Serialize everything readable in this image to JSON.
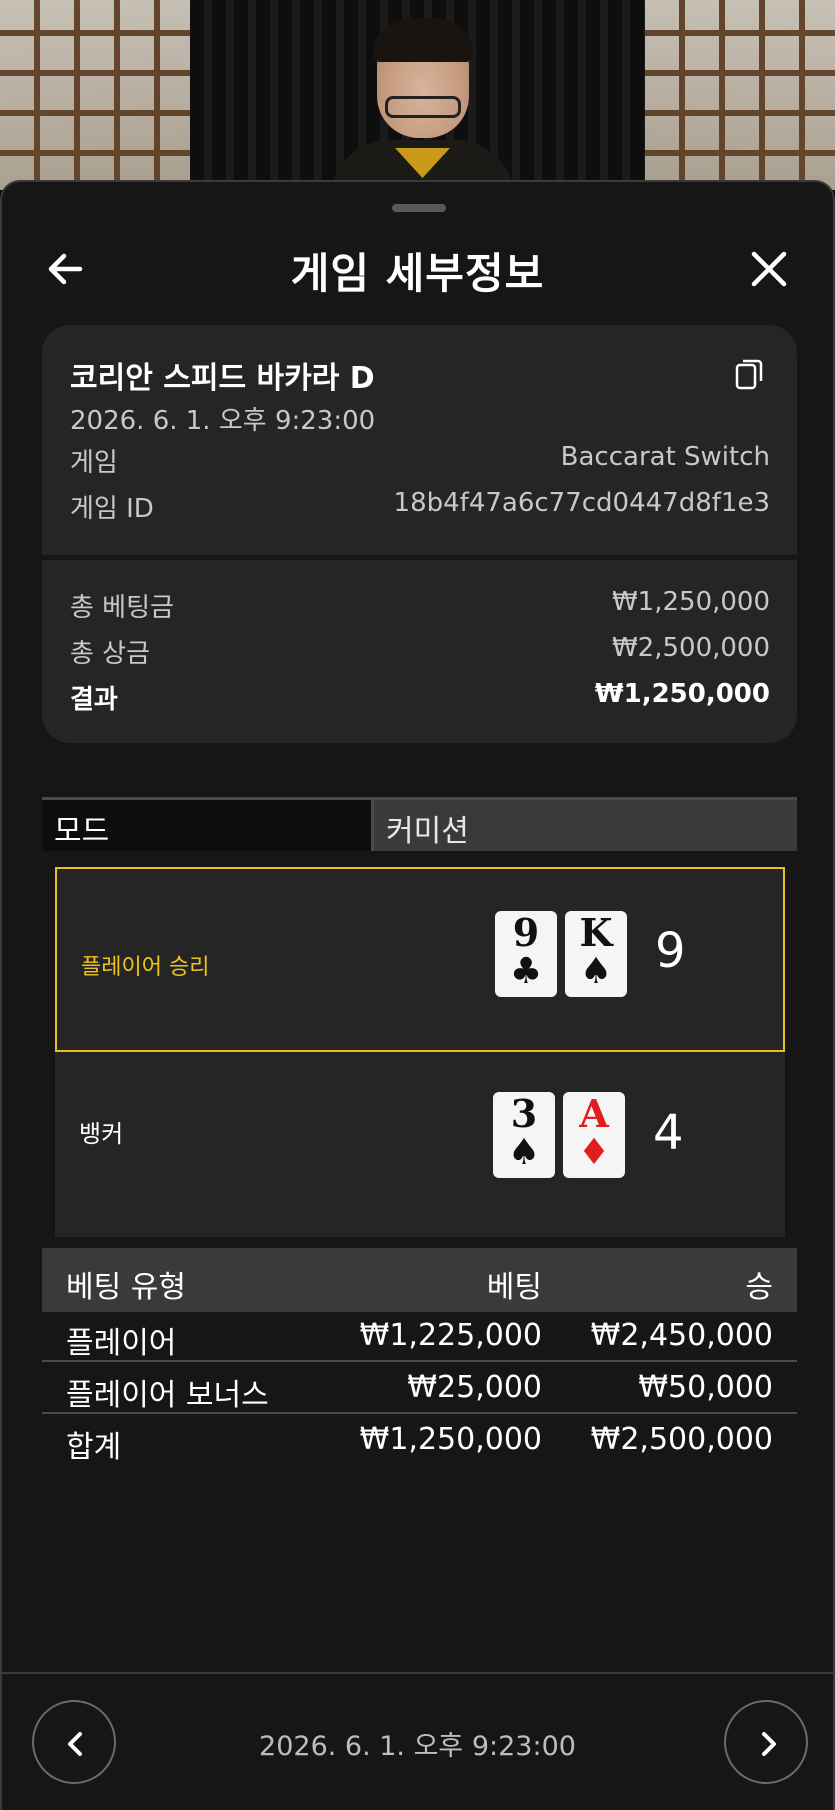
{
  "header": {
    "title": "게임 세부정보"
  },
  "info": {
    "game_name": "코리안 스피드 바카라 D",
    "date": "2026. 6. 1. 오후 9:23:00",
    "game_label": "게임",
    "game_value": "Baccarat Switch",
    "game_id_label": "게임 ID",
    "game_id_value": "18b4f47a6c77cd0447d8f1e3",
    "total_bet_label": "총 베팅금",
    "total_bet_value": "₩1,250,000",
    "total_win_label": "총 상금",
    "total_win_value": "₩2,500,000",
    "result_label": "결과",
    "result_value": "₩1,250,000"
  },
  "tabs": {
    "mode": "모드",
    "commission": "커미션"
  },
  "results": {
    "player": {
      "label": "플레이어 승리",
      "cards": [
        {
          "rank": "9",
          "suit": "♣"
        },
        {
          "rank": "K",
          "suit": "♠"
        }
      ],
      "score": "9"
    },
    "banker": {
      "label": "뱅커",
      "cards": [
        {
          "rank": "3",
          "suit": "♠"
        },
        {
          "rank": "A",
          "suit": "♦"
        }
      ],
      "score": "4"
    }
  },
  "bets": {
    "headers": {
      "type": "베팅 유형",
      "bet": "베팅",
      "win": "승"
    },
    "rows": [
      {
        "type": "플레이어",
        "bet": "₩1,225,000",
        "win": "₩2,450,000"
      },
      {
        "type": "플레이어 보너스",
        "bet": "₩25,000",
        "win": "₩50,000"
      },
      {
        "type": "합계",
        "bet": "₩1,250,000",
        "win": "₩2,500,000"
      }
    ]
  },
  "footer": {
    "date": "2026. 6. 1. 오후 9:23:00"
  },
  "colors": {
    "accent": "#e6c21a",
    "panel": "#252525",
    "sheet": "#161616"
  }
}
